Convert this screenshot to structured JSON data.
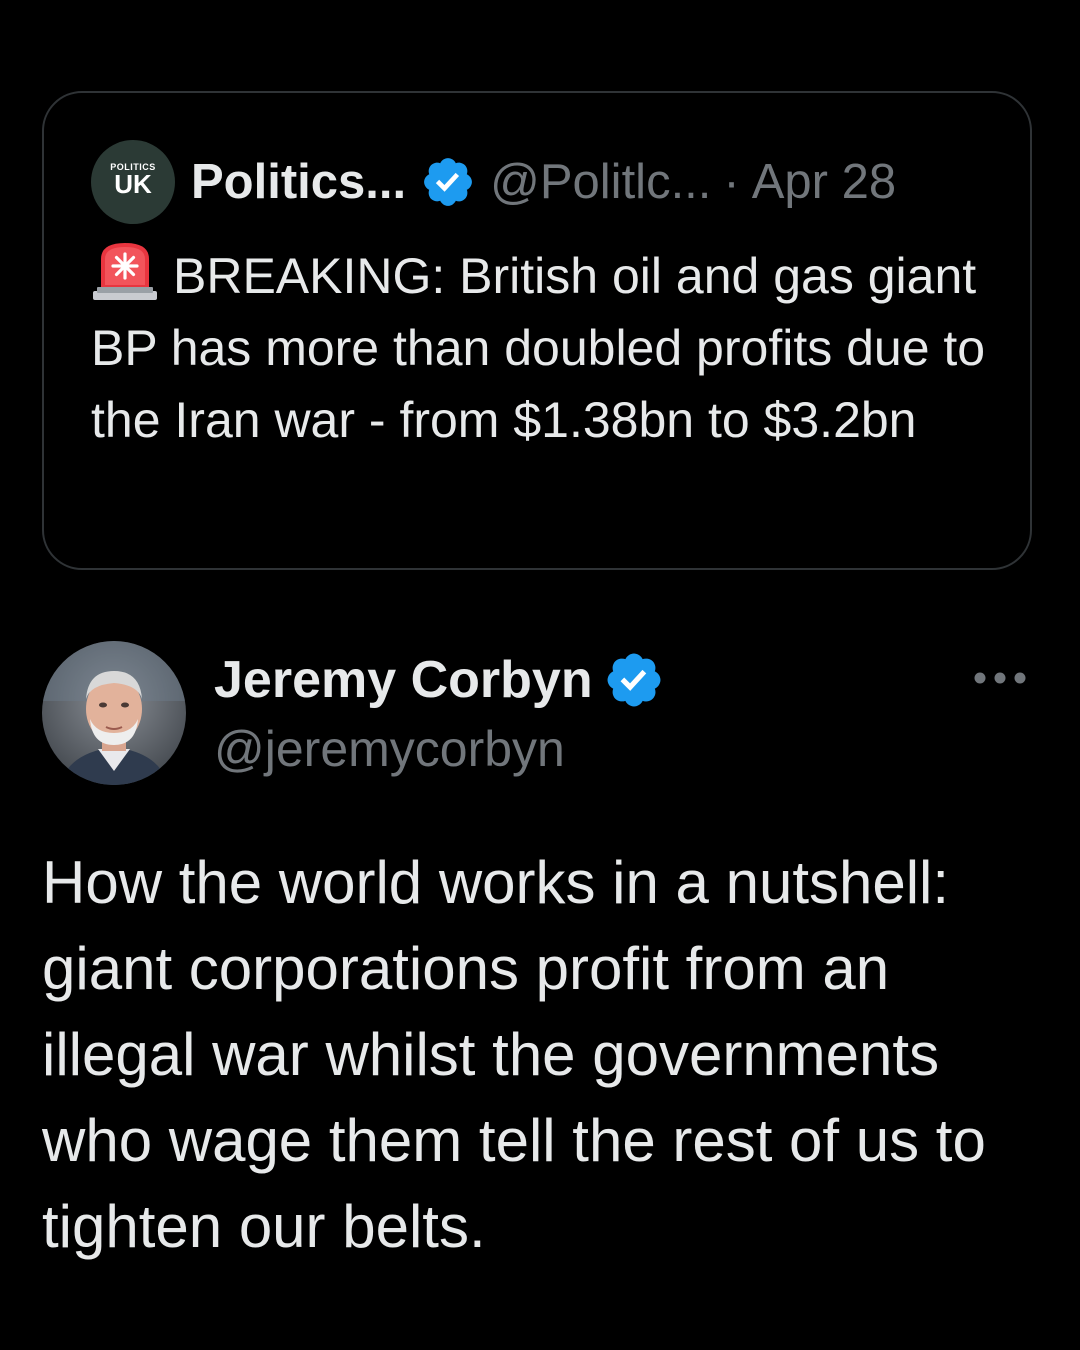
{
  "quoted_tweet": {
    "avatar_logo": {
      "small": "POLITICS",
      "big": "UK"
    },
    "display_name": "Politics...",
    "handle": "@Politlc...",
    "separator": "·",
    "date": "Apr 28",
    "verified": true,
    "leading_icon": "siren-emoji-icon",
    "text": "BREAKING: British oil and gas giant BP has more than doubled profits due to the Iran war - from $1.38bn to $3.2bn"
  },
  "tweet": {
    "display_name": "Jeremy Corbyn",
    "handle": "@jeremycorbyn",
    "verified": true,
    "more_icon": "more-dots-icon",
    "text": "How the world works in a nutshell: giant corporations profit from an illegal war whilst the governments who wage them tell the rest of us to tighten our belts."
  },
  "colors": {
    "background": "#000000",
    "text_primary": "#e7e9ea",
    "text_secondary": "#71767b",
    "border": "#2f3336",
    "verified_blue": "#1d9bf0"
  }
}
